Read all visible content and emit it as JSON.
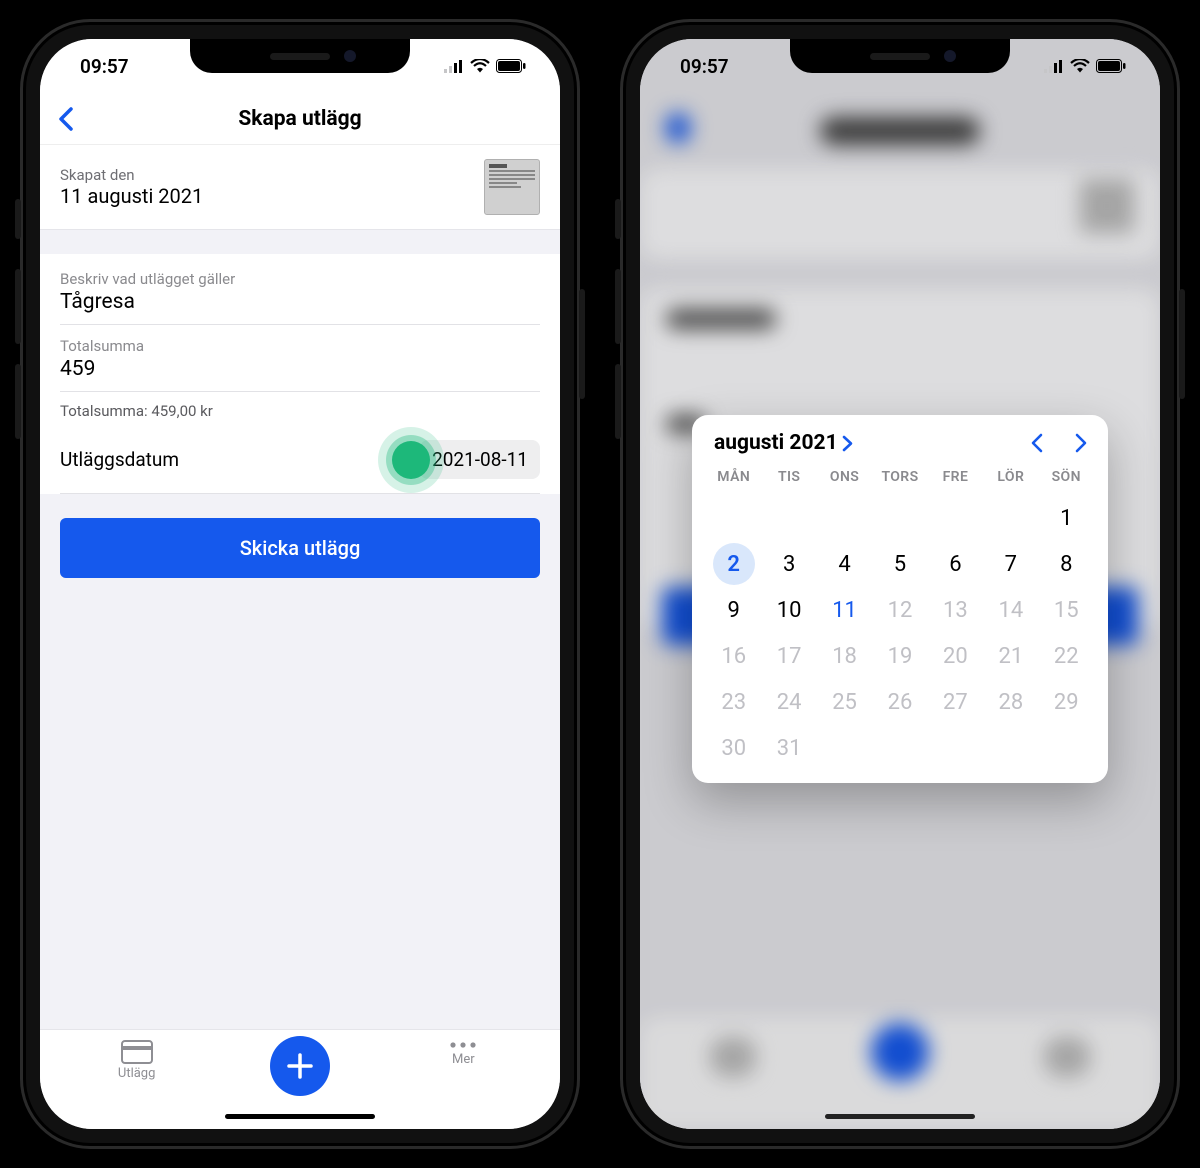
{
  "status": {
    "time": "09:57"
  },
  "phone1": {
    "nav_title": "Skapa utlägg",
    "created_label": "Skapat den",
    "created_value": "11 augusti 2021",
    "desc_label": "Beskriv vad utlägget gäller",
    "desc_value": "Tågresa",
    "total_label": "Totalsumma",
    "total_value": "459",
    "total_helper": "Totalsumma: 459,00 kr",
    "date_label": "Utläggsdatum",
    "date_value": "2021-08-11",
    "submit": "Skicka utlägg",
    "tab_expenses": "Utlägg",
    "tab_more": "Mer"
  },
  "picker": {
    "title": "augusti 2021",
    "dow": [
      "MÅN",
      "TIS",
      "ONS",
      "TORS",
      "FRE",
      "LÖR",
      "SÖN"
    ],
    "offset": 6,
    "last_day": 31,
    "selected": 2,
    "today": 11,
    "disabled_from": 12
  }
}
